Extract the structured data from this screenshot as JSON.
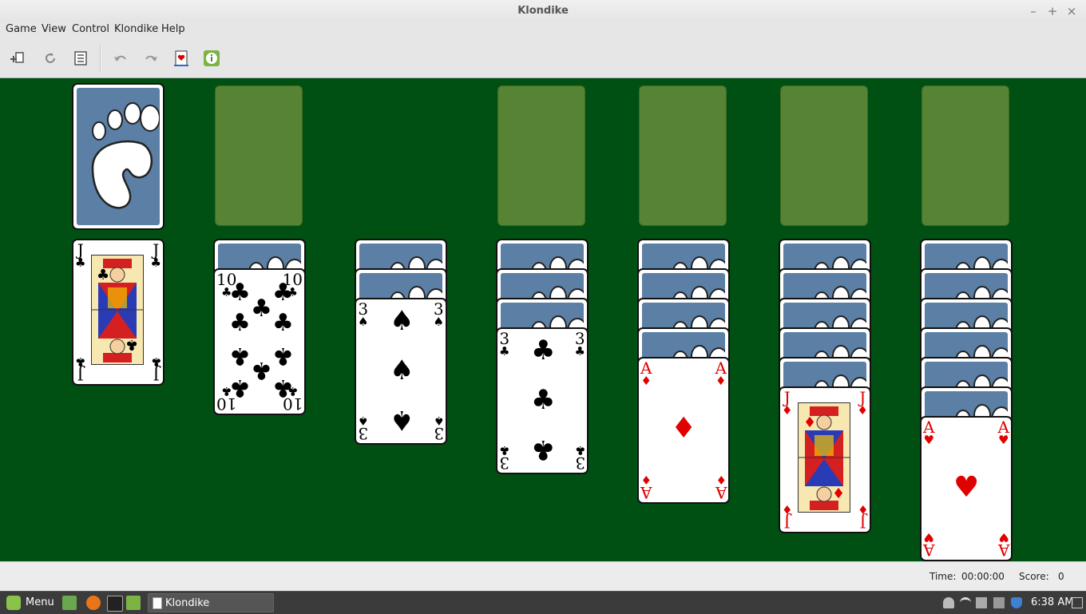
{
  "window": {
    "title": "Klondike",
    "minimize": "–",
    "maximize": "+",
    "close": "×"
  },
  "menu": [
    "Game",
    "View",
    "Control",
    "Klondike",
    "Help"
  ],
  "toolbar": {
    "buttons": [
      "new-game-icon",
      "restart-icon",
      "select-game-icon",
      "undo-icon",
      "redo-icon",
      "deal-icon",
      "hint-icon"
    ]
  },
  "game": {
    "stock": "face-down",
    "waste": "empty",
    "foundations": [
      "empty",
      "empty",
      "empty",
      "empty"
    ],
    "tableau": [
      {
        "hidden": 0,
        "top": {
          "rank": "J",
          "suit": "♣",
          "color": "black"
        }
      },
      {
        "hidden": 1,
        "top": {
          "rank": "10",
          "suit": "♣",
          "color": "black"
        }
      },
      {
        "hidden": 2,
        "top": {
          "rank": "3",
          "suit": "♠",
          "color": "black"
        }
      },
      {
        "hidden": 3,
        "top": {
          "rank": "3",
          "suit": "♣",
          "color": "black"
        }
      },
      {
        "hidden": 4,
        "top": {
          "rank": "A",
          "suit": "♦",
          "color": "red"
        }
      },
      {
        "hidden": 5,
        "top": {
          "rank": "J",
          "suit": "♦",
          "color": "red"
        }
      },
      {
        "hidden": 6,
        "top": {
          "rank": "A",
          "suit": "♥",
          "color": "red"
        }
      }
    ]
  },
  "status": {
    "time_label": "Time:",
    "time_value": "00:00:00",
    "score_label": "Score:",
    "score_value": "0"
  },
  "taskbar": {
    "menu_label": "Menu",
    "task_label": "Klondike",
    "clock": "6:38 AM"
  },
  "colors": {
    "felt": "#005013",
    "slot": "#578334",
    "card_back": "#5b7fa5",
    "red_suit": "#e00000"
  }
}
